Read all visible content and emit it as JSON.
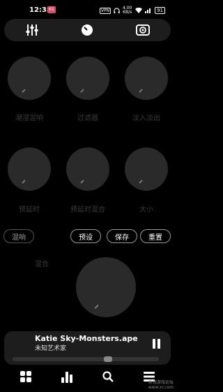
{
  "status_bar": {
    "time": "12:38",
    "badge": "61",
    "vpn": "VPN",
    "net": "4.00 KB/s",
    "battery": "91"
  },
  "top_tabs": [
    "equalizer-icon",
    "knob-icon",
    "surround-icon"
  ],
  "effects": {
    "row1": [
      "潮湿混响",
      "过滤器",
      "淡入淡出"
    ],
    "row2": [
      "预延时",
      "预延时混合",
      "大小"
    ]
  },
  "buttons": {
    "reverb": "混响",
    "preset": "预设",
    "save": "保存",
    "reset": "重置"
  },
  "mix_label": "混合",
  "now_playing": {
    "title": "Katie Sky-Monsters.ape",
    "artist": "未知艺术家",
    "progress": 0.66
  },
  "watermark": [
    "新锐游戏论坛",
    "www.xr.com"
  ],
  "colors": {
    "background": "#000000",
    "panel": "#1d1d1d",
    "knob": "#2a2a2a"
  }
}
